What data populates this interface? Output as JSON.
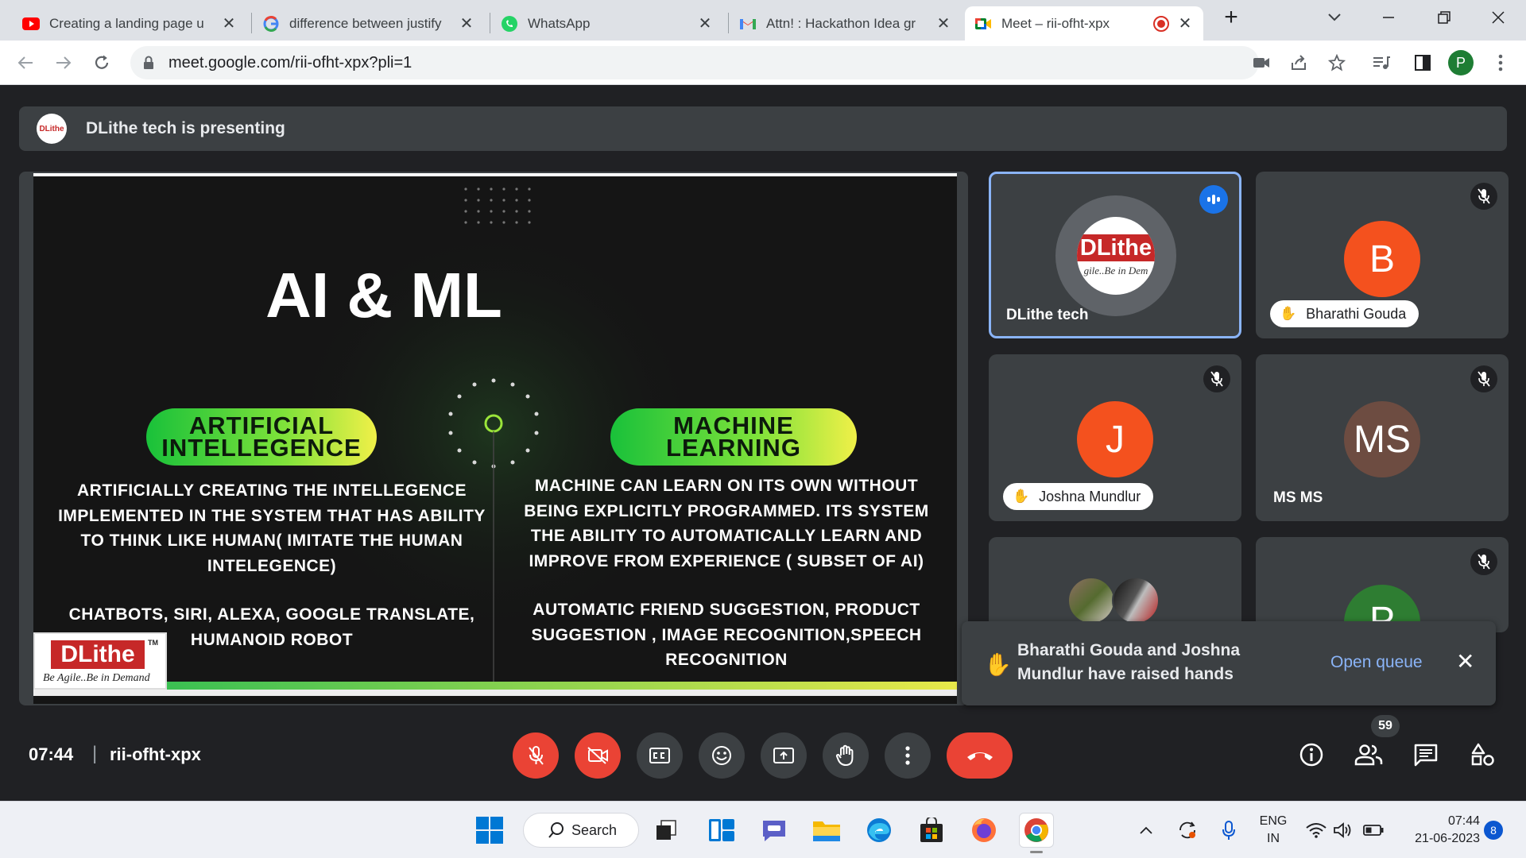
{
  "browser": {
    "tabs": [
      {
        "title": "Creating a landing page u",
        "favicon": "youtube-icon",
        "active": false
      },
      {
        "title": "difference between justify",
        "favicon": "google-icon",
        "active": false
      },
      {
        "title": "WhatsApp",
        "favicon": "whatsapp-icon",
        "active": false
      },
      {
        "title": "Attn! : Hackathon Idea gr",
        "favicon": "gmail-icon",
        "active": false
      },
      {
        "title": "Meet – rii-ofht-xpx",
        "favicon": "meet-icon",
        "active": true,
        "recording": true
      }
    ],
    "url": "meet.google.com/rii-ofht-xpx?pli=1",
    "profile_initial": "P",
    "new_tab_glyph": "+",
    "close_glyph": "✕"
  },
  "meet": {
    "presenting_banner": "DLithe tech is presenting",
    "presenter_logo_text": "DLithe",
    "slide": {
      "title": "AI & ML",
      "left_pill": "ARTIFICIAL INTELLEGENCE",
      "left_text": "ARTIFICIALLY CREATING THE INTELLEGENCE IMPLEMENTED IN THE SYSTEM THAT HAS ABILITY TO THINK LIKE HUMAN( IMITATE THE HUMAN INTELEGENCE)",
      "left_examples": "CHATBOTS, SIRI, ALEXA, GOOGLE TRANSLATE, HUMANOID ROBOT",
      "right_pill": "MACHINE LEARNING",
      "right_text": "MACHINE CAN LEARN ON ITS OWN WITHOUT BEING EXPLICITLY PROGRAMMED. ITS SYSTEM THE ABILITY TO AUTOMATICALLY LEARN AND IMPROVE FROM EXPERIENCE ( SUBSET OF AI)",
      "right_examples": "AUTOMATIC FRIEND SUGGESTION, PRODUCT SUGGESTION , IMAGE RECOGNITION,SPEECH RECOGNITION",
      "logo_text": "DLithe",
      "logo_tm": "TM",
      "logo_tagline": "Be Agile..Be in Demand"
    },
    "participants": [
      {
        "name": "DLithe tech",
        "avatar_text": "DLithe",
        "avatar_sub": "gile..Be in Dem",
        "speaking": true
      },
      {
        "name": "Bharathi Gouda",
        "initial": "B",
        "color": "#f4511e",
        "hand_raised": true,
        "muted": true
      },
      {
        "name": "Joshna Mundlur",
        "initial": "J",
        "color": "#f4511e",
        "hand_raised": true,
        "muted": true
      },
      {
        "name": "MS MS",
        "initial": "MS",
        "color": "#6d4c41",
        "muted": true
      },
      {
        "name": "",
        "initial": "",
        "photos": true
      },
      {
        "name": "",
        "initial": "P",
        "color": "#2e7d32",
        "muted": true
      }
    ],
    "toast": {
      "message": "Bharathi Gouda and Joshna Mundlur have raised hands",
      "action": "Open queue",
      "close": "✕"
    },
    "footer": {
      "time": "07:44",
      "separator": "|",
      "meeting_code": "rii-ofht-xpx",
      "participant_count": "59"
    },
    "colors": {
      "accent": "#8ab4f8",
      "danger": "#ea4335",
      "surface": "#3c4043",
      "background": "#202124"
    }
  },
  "taskbar": {
    "search_label": "Search",
    "language_top": "ENG",
    "language_bottom": "IN",
    "clock_time": "07:44",
    "clock_date": "21-06-2023",
    "notification_count": "8",
    "apps": [
      "windows-start-icon",
      "search-icon",
      "task-view-icon",
      "widgets-icon",
      "teams-chat-icon",
      "file-explorer-icon",
      "edge-icon",
      "store-icon",
      "firefox-icon",
      "chrome-icon"
    ]
  }
}
